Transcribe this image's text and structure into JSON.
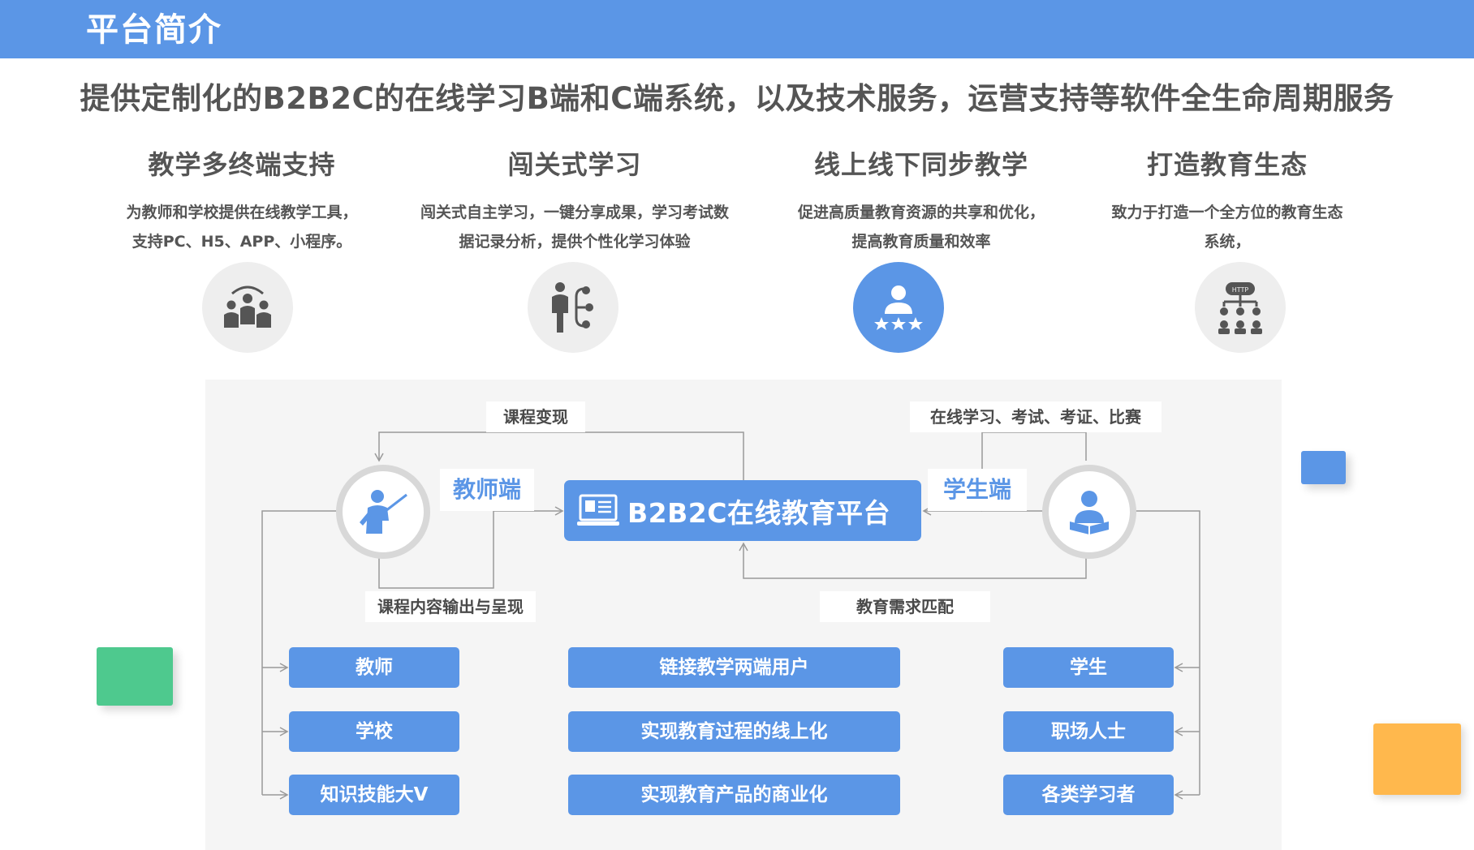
{
  "header": {
    "title": "平台简介"
  },
  "headline": "提供定制化的B2B2C的在线学习B端和C端系统，以及技术服务，运营支持等软件全生命周期服务",
  "features": [
    {
      "title": "教学多终端支持",
      "desc_line1": "为教师和学校提供在线教学工具，",
      "desc_line2": "支持PC、H5、APP、小程序。",
      "icon": "team-icon"
    },
    {
      "title": "闯关式学习",
      "desc_line1": "闯关式自主学习，一键分享成果，学习考试数",
      "desc_line2": "据记录分析，提供个性化学习体验",
      "icon": "presenter-flow-icon"
    },
    {
      "title": "线上线下同步教学",
      "desc_line1": "促进高质量教育资源的共享和优化，",
      "desc_line2": "提高教育质量和效率",
      "icon": "user-stars-icon"
    },
    {
      "title": "打造教育生态",
      "desc_line1": "致力于打造一个全方位的教育生态",
      "desc_line2": "系统，",
      "icon": "http-network-icon"
    }
  ],
  "diagram": {
    "label_top_left": "课程变现",
    "label_top_right": "在线学习、考试、考证、比赛",
    "teacher_end": "教师端",
    "student_end": "学生端",
    "platform": "B2B2C在线教育平台",
    "label_bottom_left": "课程内容输出与呈现",
    "label_bottom_right": "教育需求匹配",
    "left_pills": [
      "教师",
      "学校",
      "知识技能大V"
    ],
    "center_pills": [
      "链接教学两端用户",
      "实现教育过程的线上化",
      "实现教育产品的商业化"
    ],
    "right_pills": [
      "学生",
      "职场人士",
      "各类学习者"
    ]
  },
  "colors": {
    "accent": "#5b96e6",
    "green": "#4ec98e",
    "orange": "#ffb84d",
    "gray_circle": "#eeeeee"
  }
}
